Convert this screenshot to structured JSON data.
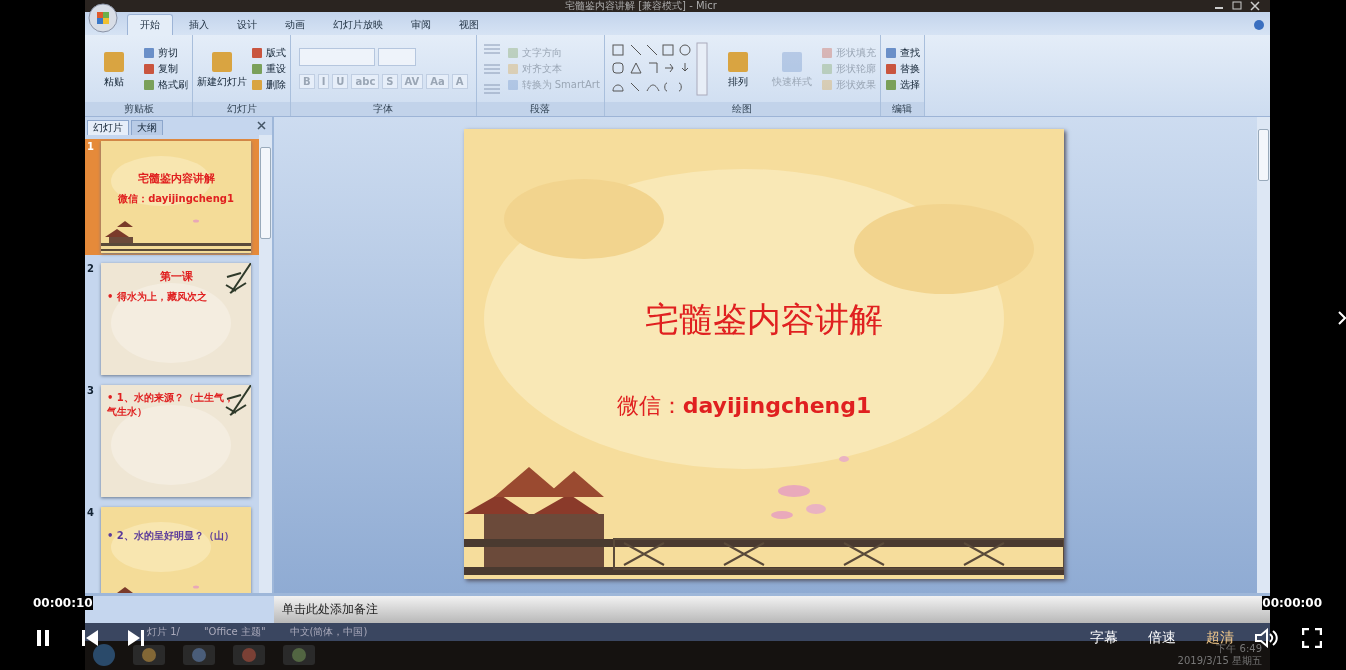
{
  "window": {
    "title": "宅髓鉴内容讲解 [兼容模式] - Micr"
  },
  "ribbon": {
    "tabs": [
      {
        "label": "开始",
        "selected": true
      },
      {
        "label": "插入",
        "selected": false
      },
      {
        "label": "设计",
        "selected": false
      },
      {
        "label": "动画",
        "selected": false
      },
      {
        "label": "幻灯片放映",
        "selected": false
      },
      {
        "label": "审阅",
        "selected": false
      },
      {
        "label": "视图",
        "selected": false
      }
    ],
    "groups": [
      {
        "label": "剪贴板",
        "items": [
          {
            "label": "粘贴",
            "kind": "large",
            "disabled": false
          },
          {
            "label": "剪切",
            "kind": "small",
            "disabled": false
          },
          {
            "label": "复制",
            "kind": "small",
            "disabled": false
          },
          {
            "label": "格式刷",
            "kind": "small",
            "disabled": false
          }
        ]
      },
      {
        "label": "幻灯片",
        "items": [
          {
            "label": "新建幻灯片",
            "kind": "large",
            "disabled": false
          },
          {
            "label": "版式",
            "kind": "small",
            "disabled": false
          },
          {
            "label": "重设",
            "kind": "small",
            "disabled": false
          },
          {
            "label": "删除",
            "kind": "small",
            "disabled": false
          }
        ]
      },
      {
        "label": "字体",
        "items": [
          {
            "label": "B",
            "kind": "glyph",
            "disabled": true
          },
          {
            "label": "I",
            "kind": "glyph",
            "disabled": true
          },
          {
            "label": "U",
            "kind": "glyph",
            "disabled": true
          },
          {
            "label": "abc",
            "kind": "glyph",
            "disabled": true
          },
          {
            "label": "S",
            "kind": "glyph",
            "disabled": true
          },
          {
            "label": "AV",
            "kind": "glyph",
            "disabled": true
          },
          {
            "label": "Aa",
            "kind": "glyph",
            "disabled": true
          },
          {
            "label": "A",
            "kind": "glyph",
            "disabled": true
          }
        ]
      },
      {
        "label": "段落",
        "items": [
          {
            "label": "文字方向",
            "kind": "small",
            "disabled": true
          },
          {
            "label": "对齐文本",
            "kind": "small",
            "disabled": true
          },
          {
            "label": "转换为 SmartArt",
            "kind": "small",
            "disabled": true
          }
        ]
      },
      {
        "label": "绘图",
        "items": [
          {
            "label": "排列",
            "kind": "large",
            "disabled": false
          },
          {
            "label": "快速样式",
            "kind": "large",
            "disabled": true
          },
          {
            "label": "形状填充",
            "kind": "small",
            "disabled": true
          },
          {
            "label": "形状轮廓",
            "kind": "small",
            "disabled": true
          },
          {
            "label": "形状效果",
            "kind": "small",
            "disabled": true
          }
        ]
      },
      {
        "label": "编辑",
        "items": [
          {
            "label": "查找",
            "kind": "small",
            "disabled": false
          },
          {
            "label": "替换",
            "kind": "small",
            "disabled": false
          },
          {
            "label": "选择",
            "kind": "small",
            "disabled": false
          }
        ]
      }
    ]
  },
  "panel": {
    "tabs": [
      {
        "label": "幻灯片",
        "selected": true
      },
      {
        "label": "大纲",
        "selected": false
      }
    ],
    "slides": [
      {
        "number": "1",
        "selected": true,
        "kind": "pavilion",
        "lines": [
          {
            "text": "宅髓鉴内容讲解",
            "kind": "title"
          },
          {
            "text": "微信：dayijingcheng1",
            "kind": "subtitle"
          }
        ]
      },
      {
        "number": "2",
        "selected": false,
        "kind": "bamboo",
        "lines": [
          {
            "text": "第一课",
            "kind": "title"
          },
          {
            "text": "• 得水为上，藏风次之",
            "kind": "bullet"
          }
        ]
      },
      {
        "number": "3",
        "selected": false,
        "kind": "bamboo",
        "lines": [
          {
            "text": "• 1、水的来源？（土生气，气生水）",
            "kind": "bullet"
          }
        ]
      },
      {
        "number": "4",
        "selected": false,
        "kind": "pavilion",
        "lines": [
          {
            "text": "• 2、水的呈好明显？（山）",
            "kind": "bullet"
          }
        ]
      }
    ]
  },
  "slide": {
    "title": "宅髓鉴内容讲解",
    "subtitle": "微信：**dayijingcheng1**"
  },
  "notes": {
    "placeholder": "单击此处添加备注"
  },
  "status_bar": [
    "灯片 1/",
    "\"Office 主题\"",
    "中文(简体，中国)"
  ],
  "taskbar": {
    "time": "下午 6:49",
    "date": "2019/3/15 星期五"
  },
  "player": {
    "elapsed": "00:00:10",
    "duration": "00:00:00",
    "playing": true,
    "subtitles": "字幕",
    "speed": "倍速",
    "quality": "超清"
  }
}
